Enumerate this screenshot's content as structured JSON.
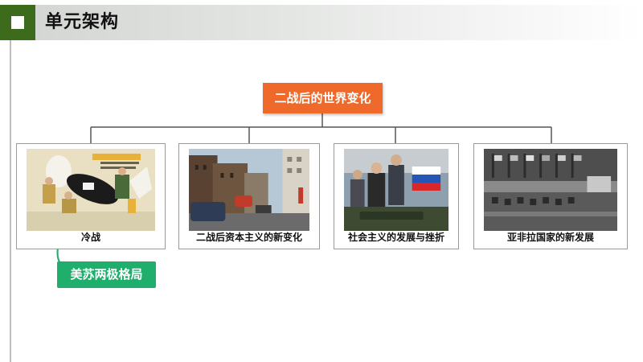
{
  "header": {
    "title": "单元架构",
    "icon": "square-bullet-icon",
    "accent_color": "#3d6b1c"
  },
  "diagram": {
    "root": {
      "label": "二战后的世界变化",
      "color": "#ef6a2a"
    },
    "children": [
      {
        "label": "冷战",
        "image": "cold-war-cartoon-photo"
      },
      {
        "label": "二战后资本主义的新变化",
        "image": "city-street-photo"
      },
      {
        "label": "社会主义的发展与挫折",
        "image": "tank-rally-photo"
      },
      {
        "label": "亚非拉国家的新发展",
        "image": "conference-hall-photo"
      }
    ],
    "sub_topic": {
      "label": "美苏两极格局",
      "parent": "冷战",
      "color": "#1fae6c"
    },
    "connector_color": "#555555",
    "sub_connector_color": "#1fae6c"
  }
}
